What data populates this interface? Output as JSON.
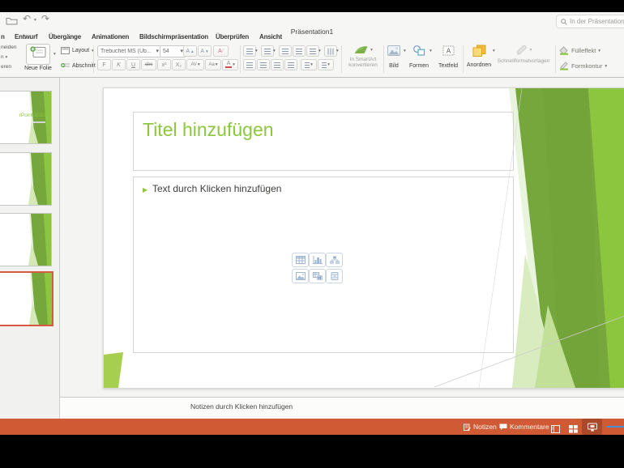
{
  "titlebar": {
    "title": "Präsentation1",
    "search_placeholder": "In der Präsentation"
  },
  "menu": {
    "cut_tab": "n",
    "tabs": [
      "Entwurf",
      "Übergänge",
      "Animationen",
      "Bildschirmpräsentation",
      "Überprüfen",
      "Ansicht"
    ]
  },
  "ribbon": {
    "clipboard": {
      "cut_fragment": "neiden",
      "copy_fragment": "n",
      "format_fragment": "eren"
    },
    "slides": {
      "new_slide": "Neue Folie",
      "layout": "Layout",
      "section": "Abschnitt"
    },
    "font": {
      "name": "Trebuchet MS (Üb...",
      "size": "54",
      "grow": "A",
      "shrink": "A",
      "clear": "A",
      "bold": "F",
      "italic": "K",
      "underline": "U",
      "strikethrough": "abc",
      "superscript": "x²",
      "subscript": "X₂",
      "char_spacing": "AV",
      "change_case": "Aa",
      "font_color": "A"
    },
    "smartart": {
      "line1": "In SmartArt",
      "line2": "konvertieren"
    },
    "insert": {
      "picture": "Bild",
      "shapes": "Formen",
      "textbox": "Textfeld"
    },
    "arrange_group": {
      "arrange": "Anordnen",
      "quick_styles": "Schnellformatvorlagen"
    },
    "shape_group": {
      "fill": "Fülleffekt",
      "outline": "Formkontur"
    }
  },
  "thumbnails": {
    "slide1_text": "rPoint 2016"
  },
  "slide": {
    "title_placeholder": "Titel hinzufügen",
    "bullet": "▶",
    "body_placeholder": "Text durch Klicken hinzufügen"
  },
  "notes": {
    "placeholder": "Notizen durch Klicken hinzufügen"
  },
  "statusbar": {
    "notes": "Notizen",
    "comments": "Kommentare"
  },
  "colors": {
    "accent_green": "#8CC63F",
    "theme_dark_green": "#76A73C",
    "status_orange": "#D05A33",
    "selected_border": "#D7593F",
    "zoom_slider_blue": "#4A90D9"
  }
}
